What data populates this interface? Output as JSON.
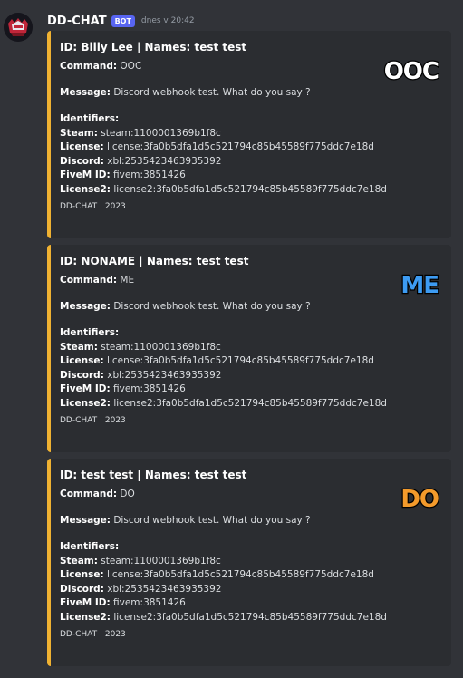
{
  "message": {
    "username": "DD-CHAT",
    "badge": "BOT",
    "timestamp": "dnes v 20:42",
    "avatar_icon": "dd-chat-logo"
  },
  "colors": {
    "embed_accent": "#f0b232",
    "ooc": "#ffffff",
    "me": "#3d9bf2",
    "do": "#f39a2b"
  },
  "embeds": [
    {
      "title": "ID: Billy Lee | Names: test test",
      "command_label": "Command:",
      "command": "OOC",
      "message_label": "Message:",
      "message": "Discord webhook test. What do you say ?",
      "identifiers_label": "Identifiers:",
      "steam_label": "Steam:",
      "steam": "steam:1100001369b1f8c",
      "license_label": "License:",
      "license": "license:3fa0b5dfa1d5c521794c85b45589f775ddc7e18d",
      "discord_label": "Discord:",
      "discord": "xbl:2535423463935392",
      "fivem_label": "FiveM ID:",
      "fivem": "fivem:3851426",
      "license2_label": "License2:",
      "license2": "license2:3fa0b5dfa1d5c521794c85b45589f775ddc7e18d",
      "footer": "DD-CHAT | 2023",
      "thumbnail": "OOC"
    },
    {
      "title": "ID: NONAME | Names: test test",
      "command_label": "Command:",
      "command": "ME",
      "message_label": "Message:",
      "message": "Discord webhook test. What do you say ?",
      "identifiers_label": "Identifiers:",
      "steam_label": "Steam:",
      "steam": "steam:1100001369b1f8c",
      "license_label": "License:",
      "license": "license:3fa0b5dfa1d5c521794c85b45589f775ddc7e18d",
      "discord_label": "Discord:",
      "discord": "xbl:2535423463935392",
      "fivem_label": "FiveM ID:",
      "fivem": "fivem:3851426",
      "license2_label": "License2:",
      "license2": "license2:3fa0b5dfa1d5c521794c85b45589f775ddc7e18d",
      "footer": "DD-CHAT | 2023",
      "thumbnail": "ME"
    },
    {
      "title": "ID: test test | Names: test test",
      "command_label": "Command:",
      "command": "DO",
      "message_label": "Message:",
      "message": "Discord webhook test. What do you say ?",
      "identifiers_label": "Identifiers:",
      "steam_label": "Steam:",
      "steam": "steam:1100001369b1f8c",
      "license_label": "License:",
      "license": "license:3fa0b5dfa1d5c521794c85b45589f775ddc7e18d",
      "discord_label": "Discord:",
      "discord": "xbl:2535423463935392",
      "fivem_label": "FiveM ID:",
      "fivem": "fivem:3851426",
      "license2_label": "License2:",
      "license2": "license2:3fa0b5dfa1d5c521794c85b45589f775ddc7e18d",
      "footer": "DD-CHAT | 2023",
      "thumbnail": "DO"
    }
  ]
}
